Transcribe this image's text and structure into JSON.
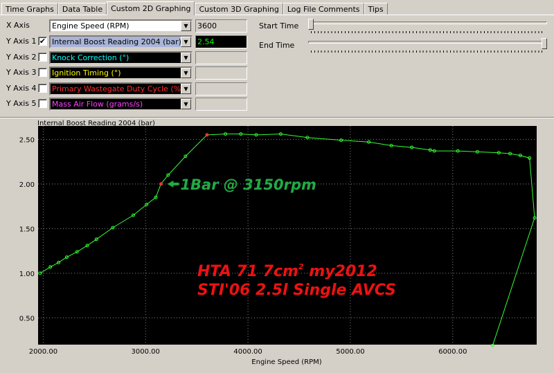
{
  "tabs": [
    {
      "label": "Time Graphs",
      "active": false
    },
    {
      "label": "Data Table",
      "active": false
    },
    {
      "label": "Custom 2D Graphing",
      "active": true
    },
    {
      "label": "Custom 3D Graphing",
      "active": false
    },
    {
      "label": "Log File Comments",
      "active": false
    },
    {
      "label": "Tips",
      "active": false
    }
  ],
  "axes": {
    "x": {
      "label": "X Axis",
      "parameter": "Engine Speed (RPM)",
      "value": "3600",
      "color": "#000000"
    },
    "y1": {
      "label": "Y Axis 1",
      "checked": true,
      "parameter": "Internal Boost Reading 2004 (bar)",
      "value": "2.54",
      "color": "#000000",
      "value_color": "#00ff00"
    },
    "y2": {
      "label": "Y Axis 2",
      "checked": false,
      "parameter": "Knock Correction (°)",
      "value": "",
      "color": "#00ffff"
    },
    "y3": {
      "label": "Y Axis 3",
      "checked": false,
      "parameter": "Ignition Timing (°)",
      "value": "",
      "color": "#ffff00"
    },
    "y4": {
      "label": "Y Axis 4",
      "checked": false,
      "parameter": "Primary Wastegate Duty Cycle (%)",
      "value": "",
      "color": "#ff3030"
    },
    "y5": {
      "label": "Y Axis 5",
      "checked": false,
      "parameter": "Mass Air Flow (grams/s)",
      "value": "",
      "color": "#ff40ff"
    }
  },
  "time_range": {
    "start_label": "Start Time",
    "end_label": "End Time",
    "start_fraction": 0.0,
    "end_fraction": 1.0
  },
  "chart_data": {
    "type": "line",
    "title": "Internal Boost Reading 2004 (bar)",
    "xlabel": "Engine Speed (RPM)",
    "ylabel": "Internal Boost Reading 2004 (bar)",
    "xlim": [
      1950,
      6820
    ],
    "ylim": [
      0.2,
      2.65
    ],
    "x_ticks": [
      "2000.00",
      "3000.00",
      "4000.00",
      "5000.00",
      "6000.00"
    ],
    "x_tick_values": [
      2000,
      3000,
      4000,
      5000,
      6000
    ],
    "y_ticks": [
      "0.50",
      "1.00",
      "1.50",
      "2.00",
      "2.50"
    ],
    "y_tick_values": [
      0.5,
      1.0,
      1.5,
      2.0,
      2.5
    ],
    "grid": true,
    "line_color": "#33ff33",
    "highlight_color": "#ff3030",
    "series": [
      {
        "x": [
          1970,
          2070,
          2150,
          2230,
          2330,
          2430,
          2520,
          2680,
          2880,
          3010,
          3100,
          3150,
          3220,
          3390,
          3600,
          3780,
          3930,
          4080,
          4320,
          4580,
          4910,
          5180,
          5400,
          5600,
          5780,
          5820,
          6050,
          6240,
          6450,
          6560,
          6660,
          6750,
          6800,
          6390
        ],
        "y": [
          1.0,
          1.07,
          1.12,
          1.18,
          1.24,
          1.31,
          1.38,
          1.51,
          1.65,
          1.77,
          1.85,
          2.0,
          2.1,
          2.31,
          2.55,
          2.56,
          2.56,
          2.55,
          2.56,
          2.52,
          2.49,
          2.47,
          2.43,
          2.41,
          2.38,
          2.37,
          2.37,
          2.36,
          2.35,
          2.34,
          2.32,
          2.29,
          1.62,
          0.19
        ],
        "highlight_indices": [
          11,
          14
        ]
      }
    ],
    "annotations": [
      {
        "text": "1Bar @ 3150rpm",
        "color": "#22aa44",
        "arrow": true,
        "x": 3150,
        "y": 2.0
      },
      {
        "text": "HTA 71  7cm",
        "superscript": "2",
        "text_after": " my2012",
        "color": "#ee1111"
      },
      {
        "text": "STI'06 2.5l Single AVCS",
        "color": "#ee1111"
      }
    ]
  }
}
